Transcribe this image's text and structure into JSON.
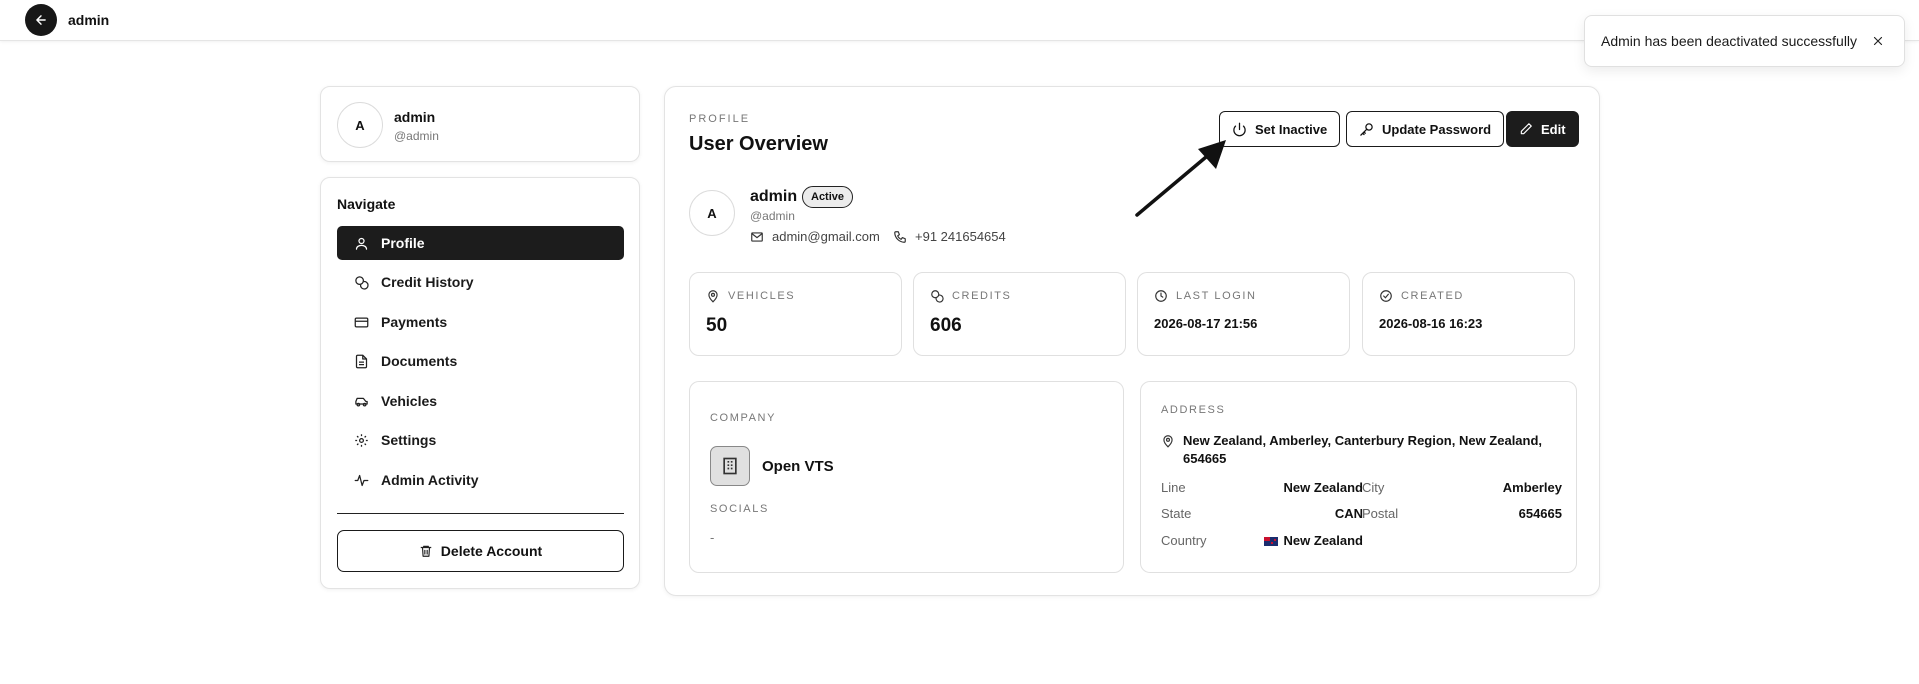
{
  "topbar": {
    "title": "admin",
    "back_icon": "arrow-left-icon"
  },
  "toast": {
    "message": "Admin has been deactivated successfully",
    "close_icon": "close-icon"
  },
  "user_card": {
    "avatar_initial": "A",
    "name": "admin",
    "handle": "@admin"
  },
  "nav": {
    "heading": "Navigate",
    "items": [
      {
        "label": "Profile",
        "icon": "user-icon",
        "active": true
      },
      {
        "label": "Credit History",
        "icon": "coins-icon",
        "active": false
      },
      {
        "label": "Payments",
        "icon": "credit-card-icon",
        "active": false
      },
      {
        "label": "Documents",
        "icon": "document-icon",
        "active": false
      },
      {
        "label": "Vehicles",
        "icon": "car-icon",
        "active": false
      },
      {
        "label": "Settings",
        "icon": "gear-icon",
        "active": false
      },
      {
        "label": "Admin Activity",
        "icon": "activity-icon",
        "active": false
      }
    ],
    "delete_label": "Delete Account"
  },
  "main": {
    "eyebrow": "PROFILE",
    "title": "User Overview",
    "actions": {
      "set_inactive": "Set Inactive",
      "update_password": "Update Password",
      "edit": "Edit"
    },
    "profile": {
      "avatar_initial": "A",
      "name": "admin",
      "status": "Active",
      "handle": "@admin",
      "email": "admin@gmail.com",
      "phone": "+91 241654654"
    },
    "stats": [
      {
        "label": "VEHICLES",
        "value": "50",
        "icon": "map-pin-icon"
      },
      {
        "label": "CREDITS",
        "value": "606",
        "icon": "coins-icon"
      },
      {
        "label": "LAST LOGIN",
        "value": "2026-08-17 21:56",
        "icon": "clock-icon"
      },
      {
        "label": "CREATED",
        "value": "2026-08-16 16:23",
        "icon": "check-circle-icon"
      }
    ],
    "company": {
      "label": "COMPANY",
      "name": "Open VTS",
      "socials_label": "SOCIALS",
      "socials_value": "-"
    },
    "address": {
      "label": "ADDRESS",
      "full": "New Zealand, Amberley, Canterbury Region, New Zealand, 654665",
      "line_label": "Line",
      "line_value": "New Zealand",
      "city_label": "City",
      "city_value": "Amberley",
      "state_label": "State",
      "state_value": "CAN",
      "postal_label": "Postal",
      "postal_value": "654665",
      "country_label": "Country",
      "country_value": "New Zealand"
    }
  },
  "colors": {
    "primary_dark": "#1c1c1c",
    "muted_text": "#777777",
    "border": "#e3e3e3",
    "badge_bg": "#ececec"
  }
}
